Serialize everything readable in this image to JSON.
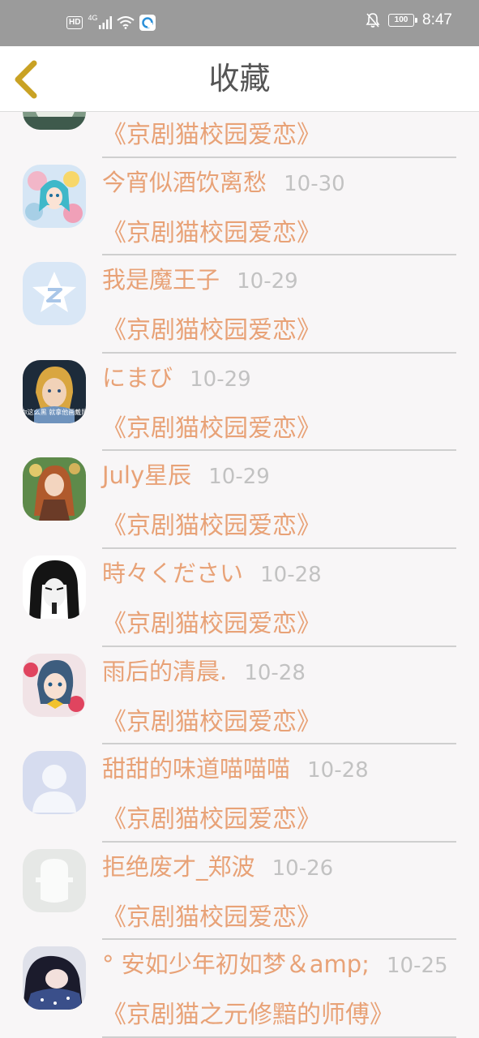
{
  "status_bar": {
    "hd_label": "HD",
    "network_label": "4G",
    "battery_level": "100",
    "time": "8:47"
  },
  "header": {
    "title": "收藏"
  },
  "colors": {
    "accent": "#e8a277",
    "back_arrow": "#c9a224",
    "date": "#c2c2c2",
    "status_bar": "#9b9b9b"
  },
  "favorites": [
    {
      "user": "",
      "date": "",
      "title": "《京剧猫校园爱恋》"
    },
    {
      "user": "今宵似酒饮离愁",
      "date": "10-30",
      "title": "《京剧猫校园爱恋》"
    },
    {
      "user": "我是魔王子",
      "date": "10-29",
      "title": "《京剧猫校园爱恋》"
    },
    {
      "user": "にまび",
      "date": "10-29",
      "title": "《京剧猫校园爱恋》"
    },
    {
      "user": "July星辰",
      "date": "10-29",
      "title": "《京剧猫校园爱恋》"
    },
    {
      "user": "時々ください",
      "date": "10-28",
      "title": "《京剧猫校园爱恋》"
    },
    {
      "user": "雨后的清晨.",
      "date": "10-28",
      "title": "《京剧猫校园爱恋》"
    },
    {
      "user": "甜甜的味道喵喵喵",
      "date": "10-28",
      "title": "《京剧猫校园爱恋》"
    },
    {
      "user": "拒绝废才_郑波",
      "date": "10-26",
      "title": "《京剧猫校园爱恋》"
    },
    {
      "user": "° 安如少年初如梦＆amp;",
      "date": "10-25",
      "title": "《京剧猫之元修黯的师傅》"
    }
  ],
  "avatar_labels": {
    "avatar_3": "看你这么黑 就拿他画戴照啊"
  }
}
